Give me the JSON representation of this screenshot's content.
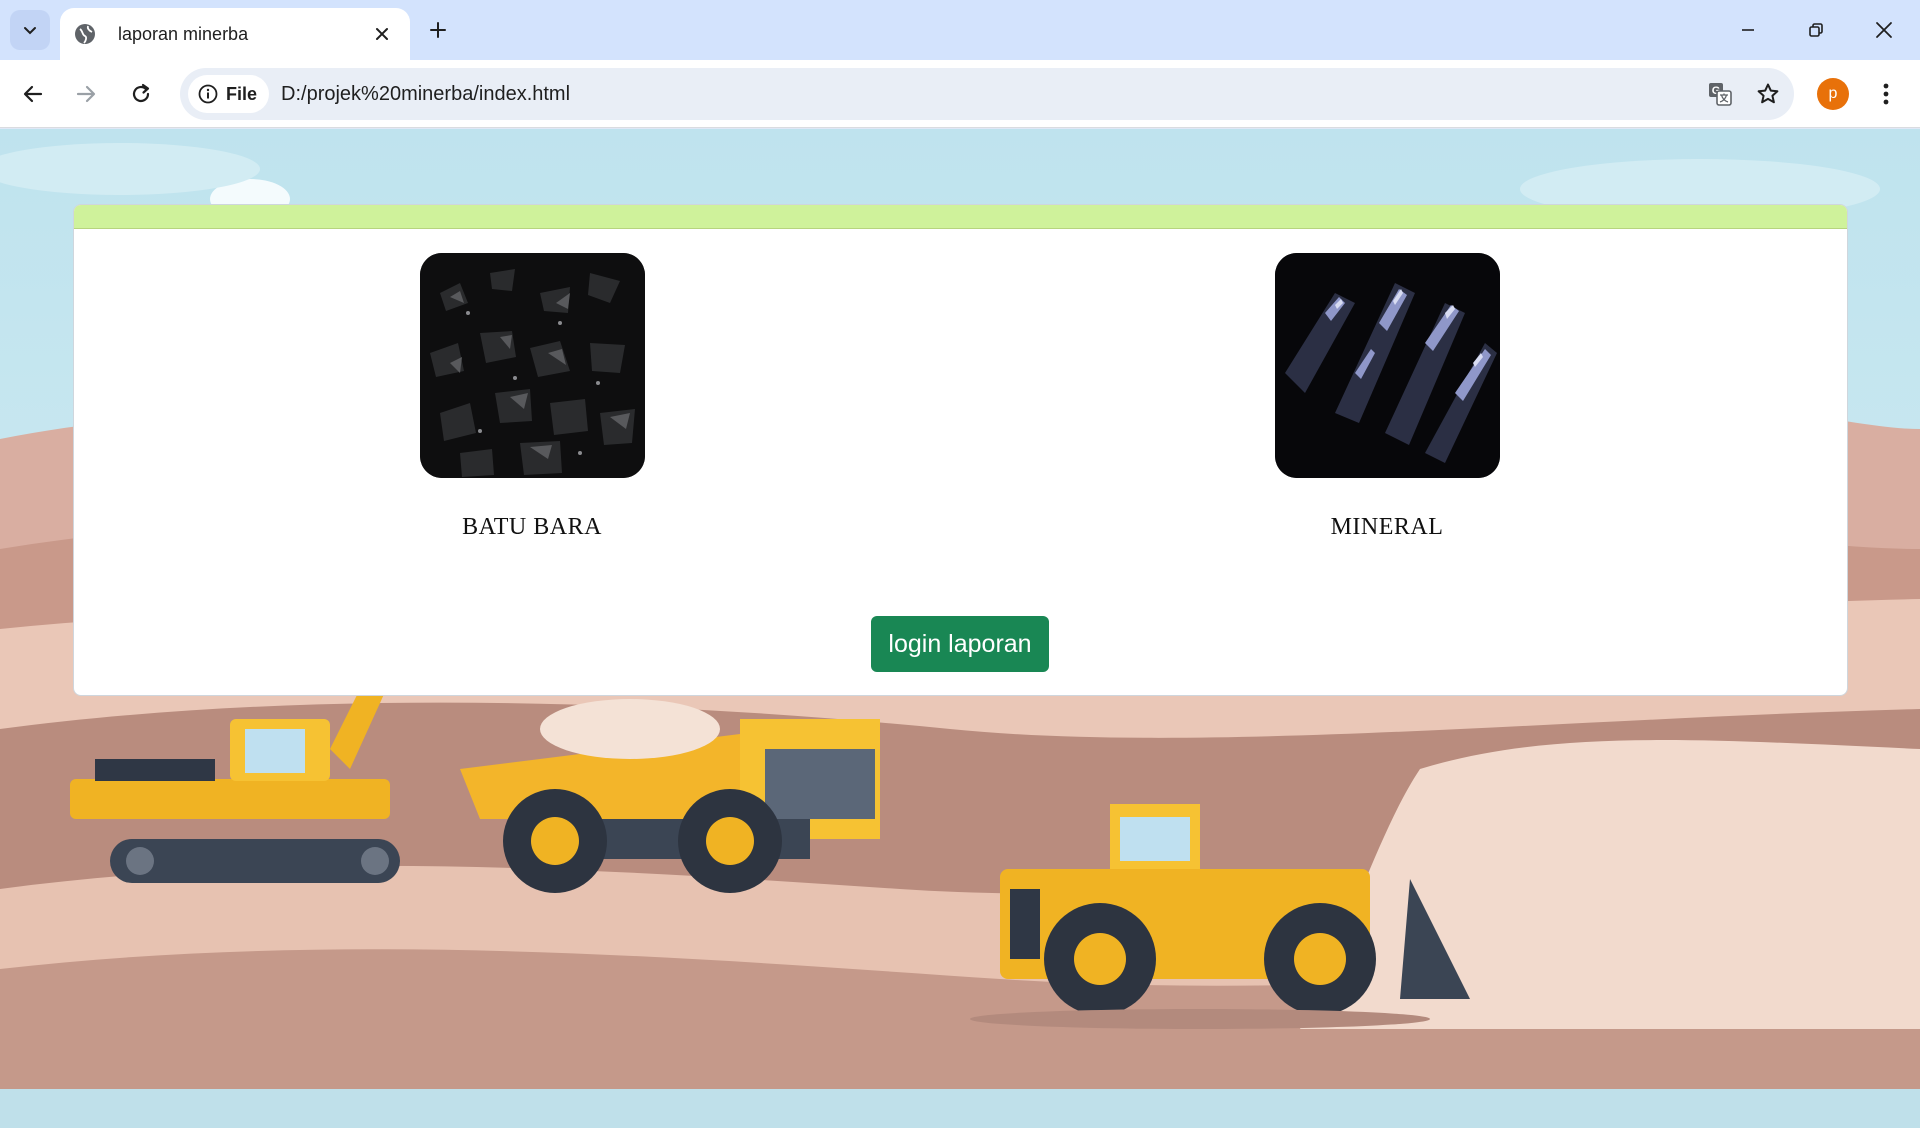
{
  "browser": {
    "tab": {
      "title": "laporan minerba"
    },
    "address_bar": {
      "chip_label": "File",
      "url": "D:/projek%20minerba/index.html"
    },
    "profile_initial": "p"
  },
  "page": {
    "items": [
      {
        "label": "BATU BARA"
      },
      {
        "label": "MINERAL"
      }
    ],
    "login_button_label": "login laporan",
    "colors": {
      "header_bar": "#cff29b",
      "login_button": "#198754",
      "sky": "#c4e4ee",
      "ground": "#e8c4b2"
    }
  }
}
